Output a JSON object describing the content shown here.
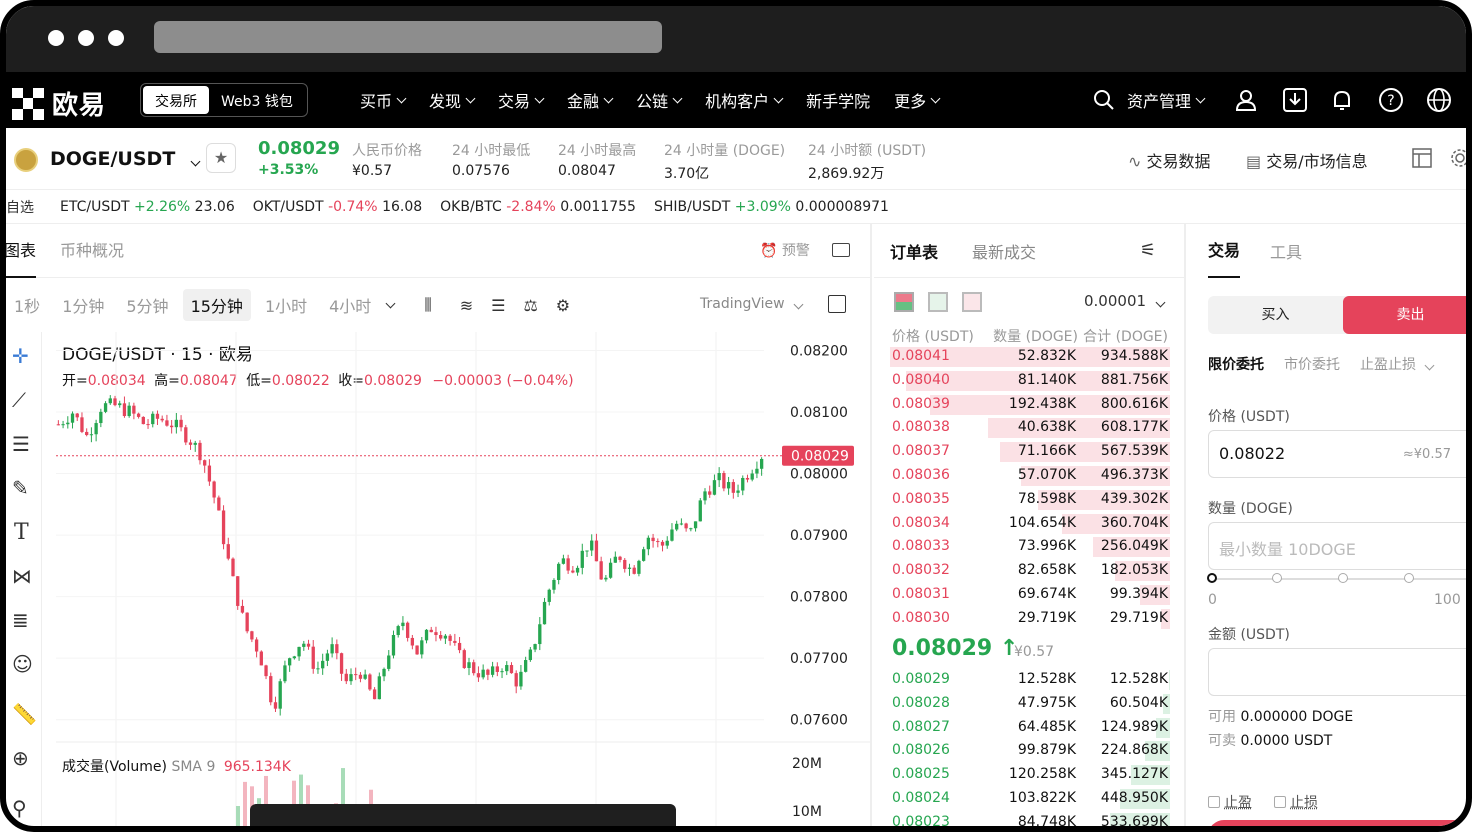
{
  "nav": {
    "logo": "欧易",
    "seg": [
      "交易所",
      "Web3 钱包"
    ],
    "menu": [
      "买币",
      "发现",
      "交易",
      "金融",
      "公链",
      "机构客户",
      "新手学院",
      "更多"
    ],
    "asset": "资产管理"
  },
  "ticker": {
    "pair": "DOGE/USDT",
    "price": "0.08029",
    "change": "+3.53%",
    "stats": [
      {
        "label": "人民币价格",
        "value": "¥0.57"
      },
      {
        "label": "24 小时最低",
        "value": "0.07576"
      },
      {
        "label": "24 小时最高",
        "value": "0.08047"
      },
      {
        "label": "24 小时量 (DOGE)",
        "value": "3.70亿"
      },
      {
        "label": "24 小时额 (USDT)",
        "value": "2,869.92万"
      }
    ],
    "links": [
      "交易数据",
      "交易/市场信息"
    ]
  },
  "strip": {
    "fav": "自选",
    "items": [
      {
        "pair": "ETC/USDT",
        "chg": "+2.26%",
        "price": "23.06"
      },
      {
        "pair": "OKT/USDT",
        "chg": "-0.74%",
        "price": "16.08"
      },
      {
        "pair": "OKB/BTC",
        "chg": "-2.84%",
        "price": "0.0011755"
      },
      {
        "pair": "SHIB/USDT",
        "chg": "+3.09%",
        "price": "0.000008971"
      }
    ]
  },
  "chart_tabs": [
    "图表",
    "币种概况"
  ],
  "alert": "预警",
  "timeframes": [
    "1秒",
    "1分钟",
    "5分钟",
    "15分钟",
    "1小时",
    "4小时"
  ],
  "tv": "TradingView",
  "chart": {
    "title": "DOGE/USDT · 15 · 欧易",
    "o_label": "开=",
    "o": "0.08034",
    "h_label": "高=",
    "h": "0.08047",
    "l_label": "低=",
    "l": "0.08022",
    "c_label": "收=",
    "c": "0.08029",
    "delta": "−0.00003 (−0.04%)",
    "last": "0.08029",
    "vol_label": "成交量(Volume)",
    "vol_sma": "SMA 9",
    "vol_value": "965.134K",
    "vol_ticks": [
      "20M",
      "10M"
    ]
  },
  "chart_data": {
    "type": "candlestick",
    "y_ticks": [
      "0.08200",
      "0.08100",
      "0.08000",
      "0.07900",
      "0.07800",
      "0.07700",
      "0.07600"
    ],
    "ylim": [
      0.0758,
      0.0823
    ],
    "close_path": [
      0.0808,
      0.081,
      0.0806,
      0.0811,
      0.0811,
      0.081,
      0.0808,
      0.0809,
      0.0808,
      0.0806,
      0.0803,
      0.0795,
      0.0784,
      0.0775,
      0.0771,
      0.0762,
      0.077,
      0.0773,
      0.0768,
      0.0772,
      0.0766,
      0.0768,
      0.0763,
      0.0771,
      0.0776,
      0.0771,
      0.0775,
      0.0774,
      0.077,
      0.0768,
      0.0767,
      0.0769,
      0.0766,
      0.0771,
      0.078,
      0.0786,
      0.0785,
      0.0789,
      0.0782,
      0.0787,
      0.0784,
      0.079,
      0.0788,
      0.0792,
      0.079,
      0.0797,
      0.0799,
      0.0797,
      0.08,
      0.0803
    ]
  },
  "orderbook": {
    "tabs": [
      "订单表",
      "最新成交"
    ],
    "precision": "0.00001",
    "cols": [
      "价格 (USDT)",
      "数量 (DOGE)",
      "合计 (DOGE)"
    ],
    "asks": [
      [
        "0.08041",
        "52.832K",
        "934.588K"
      ],
      [
        "0.08040",
        "81.140K",
        "881.756K"
      ],
      [
        "0.08039",
        "192.438K",
        "800.616K"
      ],
      [
        "0.08038",
        "40.638K",
        "608.177K"
      ],
      [
        "0.08037",
        "71.166K",
        "567.539K"
      ],
      [
        "0.08036",
        "57.070K",
        "496.373K"
      ],
      [
        "0.08035",
        "78.598K",
        "439.302K"
      ],
      [
        "0.08034",
        "104.654K",
        "360.704K"
      ],
      [
        "0.08033",
        "73.996K",
        "256.049K"
      ],
      [
        "0.08032",
        "82.658K",
        "182.053K"
      ],
      [
        "0.08031",
        "69.674K",
        "99.394K"
      ],
      [
        "0.08030",
        "29.719K",
        "29.719K"
      ]
    ],
    "mid": "0.08029 ↑",
    "mid_cny": "¥0.57",
    "bids": [
      [
        "0.08029",
        "12.528K",
        "12.528K"
      ],
      [
        "0.08028",
        "47.975K",
        "60.504K"
      ],
      [
        "0.08027",
        "64.485K",
        "124.989K"
      ],
      [
        "0.08026",
        "99.879K",
        "224.868K"
      ],
      [
        "0.08025",
        "120.258K",
        "345.127K"
      ],
      [
        "0.08024",
        "103.822K",
        "448.950K"
      ],
      [
        "0.08023",
        "84.748K",
        "533.699K"
      ]
    ]
  },
  "trade": {
    "tabs": [
      "交易",
      "工具"
    ],
    "buy": "买入",
    "sell": "卖出",
    "order_types": [
      "限价委托",
      "市价委托",
      "止盈止损"
    ],
    "price_label": "价格 (USDT)",
    "price_value": "0.08022",
    "price_cny": "≈¥0.57",
    "qty_label": "数量 (DOGE)",
    "qty_placeholder": "最小数量 10DOGE",
    "slider_min": "0",
    "slider_max": "100",
    "amount_label": "金额 (USDT)",
    "avail_label": "可用",
    "avail_value": "0.000000 DOGE",
    "sellable_label": "可卖",
    "sellable_value": "0.0000 USDT",
    "tp": "止盈",
    "sl": "止损"
  },
  "colors": {
    "up": "#26a650",
    "down": "#e5435b"
  }
}
